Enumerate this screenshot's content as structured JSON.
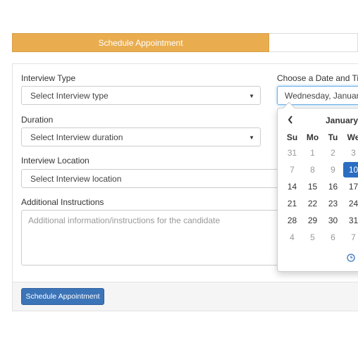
{
  "tabs": {
    "active_label": "Schedule Appointment"
  },
  "form": {
    "interview_type": {
      "label": "Interview Type",
      "value": "Select Interview type"
    },
    "date_time": {
      "label": "Choose a Date and Tim",
      "value": "Wednesday, January"
    },
    "duration": {
      "label": "Duration",
      "value": "Select Interview duration"
    },
    "location": {
      "label": "Interview Location",
      "value": "Select Interview location"
    },
    "instructions": {
      "label": "Additional Instructions",
      "placeholder": "Additional information/instructions for the candidate"
    }
  },
  "footer": {
    "submit_label": "Schedule Appointment"
  },
  "calendar": {
    "month": "January",
    "weekdays": [
      "Su",
      "Mo",
      "Tu",
      "We"
    ],
    "weeks": [
      [
        {
          "d": "31",
          "muted": true
        },
        {
          "d": "1",
          "muted": true
        },
        {
          "d": "2",
          "muted": true
        },
        {
          "d": "3",
          "muted": true
        }
      ],
      [
        {
          "d": "7",
          "muted": true
        },
        {
          "d": "8",
          "muted": true
        },
        {
          "d": "9",
          "muted": true
        },
        {
          "d": "10",
          "active": true
        }
      ],
      [
        {
          "d": "14"
        },
        {
          "d": "15"
        },
        {
          "d": "16"
        },
        {
          "d": "17"
        }
      ],
      [
        {
          "d": "21"
        },
        {
          "d": "22"
        },
        {
          "d": "23"
        },
        {
          "d": "24"
        }
      ],
      [
        {
          "d": "28"
        },
        {
          "d": "29"
        },
        {
          "d": "30"
        },
        {
          "d": "31"
        }
      ],
      [
        {
          "d": "4",
          "muted": true
        },
        {
          "d": "5",
          "muted": true
        },
        {
          "d": "6",
          "muted": true
        },
        {
          "d": "7",
          "muted": true
        }
      ]
    ],
    "icons": {
      "prev": "chevron-left-icon",
      "time": "clock-icon"
    }
  },
  "colors": {
    "tab_active": "#e9ad4f",
    "primary_button": "#3c74b8",
    "selected_day": "#2b6dc3"
  }
}
